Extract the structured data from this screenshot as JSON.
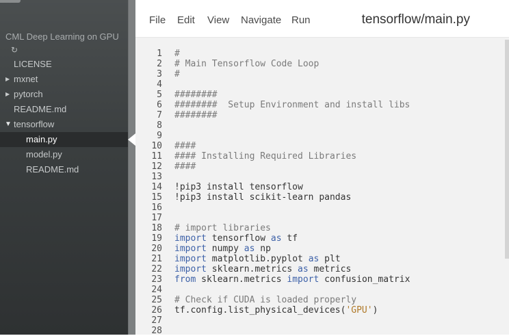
{
  "sidebar": {
    "project_title": "CML Deep Learning on GPU",
    "refresh_icon": "refresh-icon",
    "items": [
      {
        "label": "LICENSE",
        "type": "file",
        "depth": 0
      },
      {
        "label": "mxnet",
        "type": "folder",
        "depth": 0,
        "expanded": false
      },
      {
        "label": "pytorch",
        "type": "folder",
        "depth": 0,
        "expanded": false
      },
      {
        "label": "README.md",
        "type": "file",
        "depth": 0
      },
      {
        "label": "tensorflow",
        "type": "folder",
        "depth": 0,
        "expanded": true
      },
      {
        "label": "main.py",
        "type": "file",
        "depth": 1,
        "selected": true
      },
      {
        "label": "model.py",
        "type": "file",
        "depth": 1
      },
      {
        "label": "README.md",
        "type": "file",
        "depth": 1
      }
    ]
  },
  "menu": {
    "items": [
      "File",
      "Edit",
      "View",
      "Navigate",
      "Run"
    ]
  },
  "editor": {
    "file_title": "tensorflow/main.py",
    "lines": [
      {
        "n": "1",
        "tokens": [
          [
            "comment",
            "#"
          ]
        ]
      },
      {
        "n": "2",
        "tokens": [
          [
            "comment",
            "# Main Tensorflow Code Loop"
          ]
        ]
      },
      {
        "n": "3",
        "tokens": [
          [
            "comment",
            "#"
          ]
        ]
      },
      {
        "n": "4",
        "tokens": []
      },
      {
        "n": "5",
        "tokens": [
          [
            "comment",
            "########"
          ]
        ]
      },
      {
        "n": "6",
        "tokens": [
          [
            "comment",
            "########  Setup Environment and install libs"
          ]
        ]
      },
      {
        "n": "7",
        "tokens": [
          [
            "comment",
            "########"
          ]
        ]
      },
      {
        "n": "8",
        "tokens": []
      },
      {
        "n": "9",
        "tokens": []
      },
      {
        "n": "10",
        "tokens": [
          [
            "comment",
            "####"
          ]
        ]
      },
      {
        "n": "11",
        "tokens": [
          [
            "comment",
            "#### Installing Required Libraries"
          ]
        ]
      },
      {
        "n": "12",
        "tokens": [
          [
            "comment",
            "####"
          ]
        ]
      },
      {
        "n": "13",
        "tokens": []
      },
      {
        "n": "14",
        "tokens": [
          [
            "plain",
            "!pip3 install tensorflow"
          ]
        ]
      },
      {
        "n": "15",
        "tokens": [
          [
            "plain",
            "!pip3 install scikit-learn pandas"
          ]
        ]
      },
      {
        "n": "16",
        "tokens": []
      },
      {
        "n": "17",
        "tokens": []
      },
      {
        "n": "18",
        "tokens": [
          [
            "comment",
            "# import libraries"
          ]
        ]
      },
      {
        "n": "19",
        "tokens": [
          [
            "kw",
            "import"
          ],
          [
            "plain",
            " tensorflow "
          ],
          [
            "kw",
            "as"
          ],
          [
            "plain",
            " tf"
          ]
        ]
      },
      {
        "n": "20",
        "tokens": [
          [
            "kw",
            "import"
          ],
          [
            "plain",
            " numpy "
          ],
          [
            "kw",
            "as"
          ],
          [
            "plain",
            " np"
          ]
        ]
      },
      {
        "n": "21",
        "tokens": [
          [
            "kw",
            "import"
          ],
          [
            "plain",
            " matplotlib.pyplot "
          ],
          [
            "kw",
            "as"
          ],
          [
            "plain",
            " plt"
          ]
        ]
      },
      {
        "n": "22",
        "tokens": [
          [
            "kw",
            "import"
          ],
          [
            "plain",
            " sklearn.metrics "
          ],
          [
            "kw",
            "as"
          ],
          [
            "plain",
            " metrics"
          ]
        ]
      },
      {
        "n": "23",
        "tokens": [
          [
            "kw",
            "from"
          ],
          [
            "plain",
            " sklearn.metrics "
          ],
          [
            "kw",
            "import"
          ],
          [
            "plain",
            " confusion_matrix"
          ]
        ]
      },
      {
        "n": "24",
        "tokens": []
      },
      {
        "n": "25",
        "tokens": [
          [
            "comment",
            "# Check if CUDA is loaded properly"
          ]
        ]
      },
      {
        "n": "26",
        "tokens": [
          [
            "plain",
            "tf.config.list_physical_devices("
          ],
          [
            "str",
            "'GPU'"
          ],
          [
            "plain",
            ")"
          ]
        ]
      },
      {
        "n": "27",
        "tokens": []
      },
      {
        "n": "28",
        "tokens": []
      }
    ]
  },
  "colors": {
    "keyword": "#3d61a8",
    "comment": "#7a7a7a",
    "string": "#b07a2a",
    "sidebar_bg": "#3f4344",
    "editor_bg": "#f2f2f2"
  }
}
